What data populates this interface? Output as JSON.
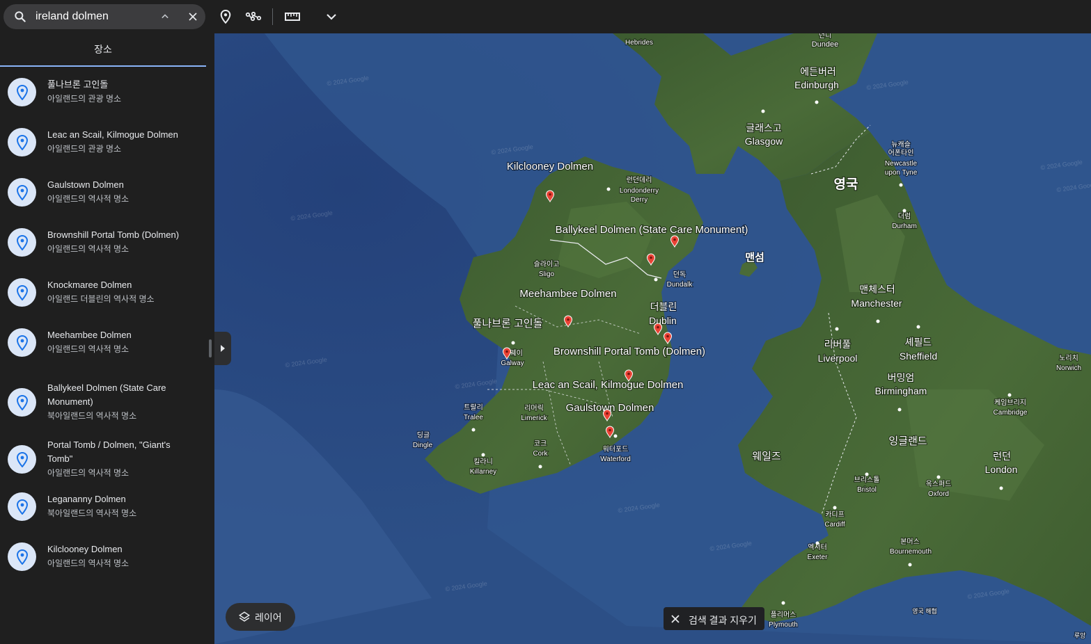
{
  "search": {
    "value": "ireland dolmen"
  },
  "sidebar": {
    "tab_label": "장소",
    "results": [
      {
        "title": "풀나브론 고인돌",
        "subtitle": "아일랜드의 관광 명소"
      },
      {
        "title": "Leac an Scail, Kilmogue Dolmen",
        "subtitle": "아일랜드의 관광 명소"
      },
      {
        "title": "Gaulstown Dolmen",
        "subtitle": "아일랜드의 역사적 명소"
      },
      {
        "title": "Brownshill Portal Tomb (Dolmen)",
        "subtitle": "아일랜드의 역사적 명소"
      },
      {
        "title": "Knockmaree Dolmen",
        "subtitle": "아일랜드 더블린의 역사적 명소"
      },
      {
        "title": "Meehambee Dolmen",
        "subtitle": "아일랜드의 역사적 명소"
      },
      {
        "title": "Ballykeel Dolmen (State Care Monument)",
        "subtitle": "북아일랜드의 역사적 명소"
      },
      {
        "title": "Portal Tomb / Dolmen, \"Giant's Tomb\"",
        "subtitle": "아일랜드의 역사적 명소"
      },
      {
        "title": "Legananny Dolmen",
        "subtitle": "북아일랜드의 역사적 명소"
      },
      {
        "title": "Kilclooney Dolmen",
        "subtitle": "아일랜드의 역사적 명소"
      }
    ]
  },
  "map": {
    "dolmen_labels": {
      "kilclooney": "Kilclooney Dolmen",
      "ballykeel": "Ballykeel Dolmen (State Care Monument)",
      "meehambee": "Meehambee Dolmen",
      "poulnabrone": "풀나브론 고인돌",
      "brownshill": "Brownshill Portal Tomb (Dolmen)",
      "leac": "Leac an Scail, Kilmogue Dolmen",
      "gaulstown": "Gaulstown Dolmen"
    },
    "places": {
      "hebrides": "Hebrides",
      "dundee_ko": "던디",
      "dundee": "Dundee",
      "edinburgh_ko": "에든버러",
      "edinburgh": "Edinburgh",
      "glasgow_ko": "글래스고",
      "glasgow": "Glasgow",
      "newcastle_ko1": "뉴캐슬",
      "newcastle_ko2": "어폰타인",
      "newcastle1": "Newcastle",
      "newcastle2": "upon Tyne",
      "uk": "영국",
      "durham_ko": "더럼",
      "durham": "Durham",
      "londonderry_ko": "런던데리",
      "londonderry1": "Londonderry",
      "londonderry2": "Derry",
      "isle_of_man": "맨섬",
      "sligo_ko": "슬라이고",
      "sligo": "Sligo",
      "dundalk_ko": "던독",
      "dundalk": "Dundalk",
      "manchester_ko": "맨체스터",
      "manchester": "Manchester",
      "dublin_ko": "더블린",
      "dublin": "Dublin",
      "liverpool_ko": "리버풀",
      "liverpool": "Liverpool",
      "sheffield_ko": "셰필드",
      "sheffield": "Sheffield",
      "galway_ko": "골웨이",
      "galway": "Galway",
      "norwich_ko": "노리치",
      "norwich": "Norwich",
      "birmingham_ko": "버밍엄",
      "birmingham": "Birmingham",
      "tralee_ko": "트랄리",
      "tralee": "Tralee",
      "limerick_ko": "리머릭",
      "limerick": "Limerick",
      "cambridge_ko": "케임브리지",
      "cambridge": "Cambridge",
      "dingle_ko": "딩글",
      "dingle": "Dingle",
      "cork_ko": "코크",
      "cork": "Cork",
      "waterford_ko": "워터포드",
      "waterford": "Waterford",
      "england": "잉글랜드",
      "wales": "웨일즈",
      "london_ko": "런던",
      "london": "London",
      "killarney_ko": "킬라니",
      "killarney": "Killarney",
      "bristol_ko": "브리스톨",
      "bristol": "Bristol",
      "oxford_ko": "옥스퍼드",
      "oxford": "Oxford",
      "cardiff_ko": "카디프",
      "cardiff": "Cardiff",
      "exeter_ko": "엑서터",
      "exeter": "Exeter",
      "bournemouth_ko": "본머스",
      "bournemouth": "Bournemouth",
      "plymouth_ko": "플리머스",
      "plymouth": "Plymouth",
      "channel": "영국 해협",
      "rouen": "루앙"
    },
    "watermark": "© 2024 Google"
  },
  "layers_button": {
    "label": "레이어"
  },
  "clear_button": {
    "label": "검색 결과 지우기"
  },
  "colors": {
    "accent": "#8ab4f8",
    "pin": "#ea4335",
    "sea": "#2b4f8a",
    "land": "#3d5f30"
  }
}
